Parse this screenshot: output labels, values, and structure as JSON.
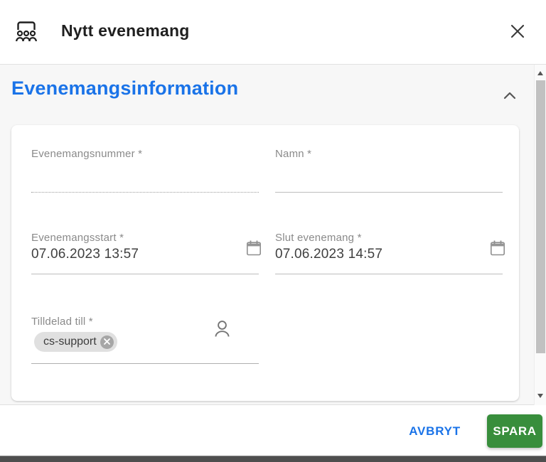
{
  "dialog": {
    "title": "Nytt evenemang"
  },
  "section": {
    "title": "Evenemangsinformation",
    "collapsed": false
  },
  "fields": {
    "event_number": {
      "label": "Evenemangsnummer *",
      "value": "",
      "disabled": true
    },
    "name": {
      "label": "Namn *",
      "value": ""
    },
    "event_start": {
      "label": "Evenemangsstart *",
      "value": "07.06.2023 13:57"
    },
    "event_end": {
      "label": "Slut evenemang *",
      "value": "07.06.2023 14:57"
    },
    "assigned_to": {
      "label": "Tilldelad till *",
      "chips": [
        "cs-support"
      ]
    }
  },
  "footer": {
    "cancel_label": "AVBRYT",
    "save_label": "SPARA"
  },
  "icons": {
    "header": "event-audience-icon",
    "close": "close-icon",
    "section_chevron": "chevron-up-icon",
    "date_picker": "calendar-icon",
    "assignee_picker": "person-icon",
    "chip_remove": "circle-x-icon",
    "scroll_up": "triangle-up-icon",
    "scroll_down": "triangle-down-icon"
  },
  "colors": {
    "accent_blue": "#1a73e8",
    "save_green": "#388e3c",
    "label_gray": "#8a8a8a",
    "value_text": "#3f3f3f",
    "chip_bg": "#e0e0e0",
    "content_bg": "#f7f7f7",
    "bottom_bar": "#4e4e4e"
  }
}
